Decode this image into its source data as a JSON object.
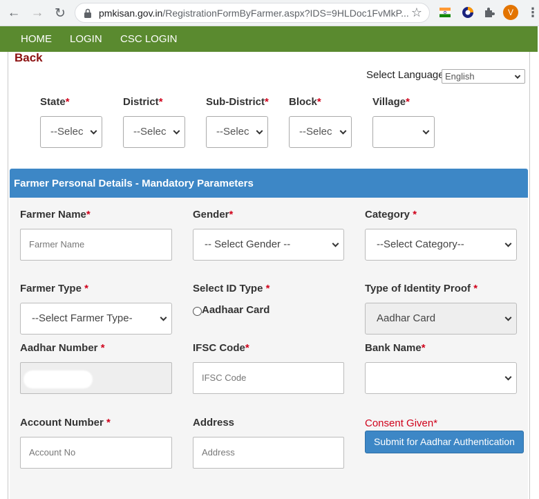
{
  "browser": {
    "url_host": "pmkisan.gov.in",
    "url_path": "/RegistrationFormByFarmer.aspx?IDS=9HLDoc1FvMkP...",
    "profile_initial": "V"
  },
  "nav": {
    "home": "HOME",
    "login": "LOGIN",
    "csc_login": "CSC LOGIN"
  },
  "back_label": "Back",
  "language": {
    "label": "Select Language",
    "selected": "English"
  },
  "location": {
    "state": {
      "label": "State",
      "value": "--Selec"
    },
    "district": {
      "label": "District",
      "value": "--Selec"
    },
    "sub_district": {
      "label": "Sub-District",
      "value": "--Selec"
    },
    "block": {
      "label": "Block",
      "value": "--Selec"
    },
    "village": {
      "label": "Village",
      "value": ""
    }
  },
  "required_mark": "*",
  "panel": {
    "title": "Farmer Personal Details - Mandatory Parameters",
    "farmer_name": {
      "label": "Farmer Name",
      "placeholder": "Farmer Name"
    },
    "gender": {
      "label": "Gender",
      "value": "-- Select Gender --"
    },
    "category": {
      "label": "Category ",
      "value": "--Select Category--"
    },
    "farmer_type": {
      "label": "Farmer Type ",
      "value": "--Select Farmer Type-"
    },
    "select_id_type": {
      "label": "Select ID Type ",
      "option": "Aadhaar Card"
    },
    "identity_proof": {
      "label": "Type of Identity Proof ",
      "value": "Aadhar Card"
    },
    "aadhar_number": {
      "label": "Aadhar Number "
    },
    "ifsc": {
      "label": "IFSC Code",
      "placeholder": "IFSC Code"
    },
    "bank_name": {
      "label": "Bank Name",
      "value": ""
    },
    "account_number": {
      "label": "Account Number ",
      "placeholder": "Account No"
    },
    "address": {
      "label": "Address",
      "placeholder": "Address"
    },
    "consent": "Consent Given*",
    "submit": "Submit for Aadhar Authentication"
  }
}
